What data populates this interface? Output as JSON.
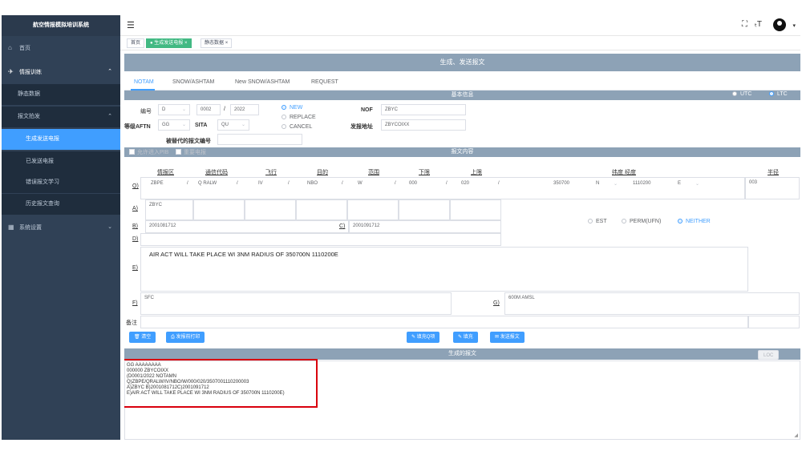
{
  "sidebar": {
    "title": "航空情报模拟培训系统",
    "items": [
      {
        "icon": "⌂",
        "label": "首页"
      },
      {
        "icon": "✈",
        "label": "情报训练"
      },
      {
        "label": "静态数据"
      },
      {
        "label": "报文拍发"
      },
      {
        "label": "生成发送电报"
      },
      {
        "label": "已发送电报"
      },
      {
        "label": "错误报文学习"
      },
      {
        "label": "历史报文查询"
      },
      {
        "icon": "▦",
        "label": "系统设置"
      }
    ]
  },
  "tags": {
    "home": "首页",
    "gen": "生成发送电报",
    "gen_close": "×",
    "static": "静态数据",
    "static_close": "×"
  },
  "page": {
    "title": "生成、发送报文",
    "tabs": [
      "NOTAM",
      "SNOW/ASHTAM",
      "New SNOW/ASHTAM",
      "REQUEST"
    ],
    "basic_info": "基本信息",
    "utc": "UTC",
    "ltc": "LTC",
    "body_title": "报文内容",
    "gen_title": "生成的报文",
    "loc_btn": "LOC"
  },
  "basic": {
    "number_label": "编号",
    "series": "D",
    "num": "0002",
    "slash": "/",
    "year": "2022",
    "new": "NEW",
    "replace": "REPLACE",
    "cancel": "CANCEL",
    "nof_label": "NOF",
    "nof": "ZBYC",
    "level_label": "等级AFTN",
    "level": "GG",
    "sita_label": "SITA",
    "sita": "QU",
    "send_addr_label": "发报地址",
    "send_addr": "ZBYCOIXX",
    "replaced_label": "被替代的报文编号",
    "allow_label": "允许进入PIB",
    "repeat_label": "重要电报"
  },
  "body": {
    "headers": [
      "情报区",
      "通信代码",
      "飞行",
      "目的",
      "范围",
      "下限",
      "上限",
      "纬度 经度",
      "半径"
    ],
    "q_label": "Q)",
    "q_fir": "ZBPE",
    "q_sep1": "/",
    "q_code": "Q RALW",
    "q_sep2": "/",
    "q_flight": "IV",
    "q_sep3": "/",
    "q_purpose": "NBO",
    "q_sep4": "/",
    "q_scope": "W",
    "q_sep5": "/",
    "q_lower": "000",
    "q_sep6": "/",
    "q_upper": "020",
    "q_sep7": "/",
    "q_lat": "350700",
    "q_ns": "N",
    "q_lon": "1110200",
    "q_ew": "E",
    "q_radius": "003",
    "a_label": "A)",
    "a_value": "ZBYC",
    "b_label": "B)",
    "b_value": "2001081712",
    "c_label": "C)",
    "c_value": "2001091712",
    "d_label": "D)",
    "est": "EST",
    "perm": "PERM(UFN)",
    "neither": "NEITHER",
    "e_label": "E)",
    "e_value": "AIR ACT WILL TAKE PLACE WI 3NM RADIUS OF 350700N 1110200E",
    "f_label": "F)",
    "f_value": "SFC",
    "g_label": "G)",
    "g_value": "600M AMSL",
    "remark_label": "备注"
  },
  "buttons": {
    "clear": "清空",
    "print": "发报前打印",
    "fill_q": "填充Q项",
    "fill": "填充",
    "send": "发送报文"
  },
  "generated": [
    "GG AAAAAAAA",
    "000000 ZBYCOIXX",
    "(D0001/2022 NOTAMN",
    "Q)ZBPE/QRALW/IV/NBO/W/000/020/3507001110200003",
    "A)ZBYC      B)2001081712C)2001091712",
    "E)AIR ACT WILL TAKE PLACE WI 3NM RADIUS OF 350700N 1110200E)"
  ]
}
